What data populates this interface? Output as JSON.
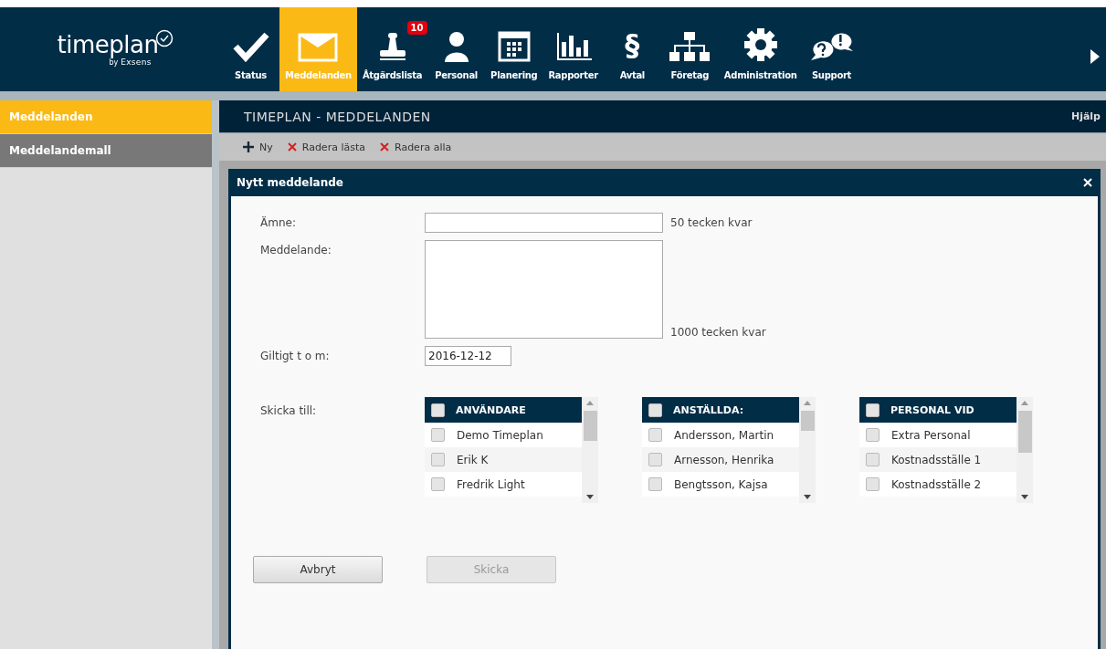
{
  "logo": {
    "name": "timeplan",
    "by": "by",
    "brand": "Exsens"
  },
  "nav": [
    {
      "label": "Status",
      "kind": "check",
      "selected": false
    },
    {
      "label": "Meddelanden",
      "kind": "envelope",
      "selected": true
    },
    {
      "label": "Åtgärdslista",
      "kind": "stamp",
      "selected": false,
      "badge": "10"
    },
    {
      "label": "Personal",
      "kind": "person",
      "selected": false
    },
    {
      "label": "Planering",
      "kind": "calendar",
      "selected": false
    },
    {
      "label": "Rapporter",
      "kind": "chart",
      "selected": false
    },
    {
      "label": "Avtal",
      "kind": "glyph",
      "glyph": "§",
      "selected": false
    },
    {
      "label": "Företag",
      "kind": "org",
      "selected": false
    },
    {
      "label": "Administration",
      "kind": "gear",
      "selected": false
    },
    {
      "label": "Support",
      "kind": "support",
      "selected": false
    }
  ],
  "sidebar": {
    "items": [
      {
        "label": "Meddelanden",
        "selected": true
      },
      {
        "label": "Meddelandemall",
        "selected": false
      }
    ]
  },
  "page": {
    "title": "TIMEPLAN - MEDDELANDEN",
    "help": "Hjälp"
  },
  "toolbar": [
    {
      "label": "Ny",
      "kind": "add"
    },
    {
      "label": "Radera lästa",
      "kind": "delete"
    },
    {
      "label": "Radera alla",
      "kind": "delete"
    }
  ],
  "dialog": {
    "title": "Nytt meddelande",
    "subject": {
      "label": "Ämne:",
      "counter": "50 tecken kvar"
    },
    "message": {
      "label": "Meddelande:",
      "counter": "1000 tecken kvar"
    },
    "valid_until": {
      "label": "Giltigt t o m:",
      "value": "2016-12-12"
    },
    "send_to": {
      "label": "Skicka till:",
      "lists": [
        {
          "header": "ANVÄNDARE",
          "checked": false,
          "items": [
            {
              "name": "Demo Timeplan",
              "checked": false
            },
            {
              "name": "Erik K",
              "checked": false
            },
            {
              "name": "Fredrik Light",
              "checked": false
            }
          ]
        },
        {
          "header": "ANSTÄLLDA:",
          "checked": false,
          "items": [
            {
              "name": "Andersson, Martin",
              "checked": false
            },
            {
              "name": "Arnesson, Henrika",
              "checked": false
            },
            {
              "name": "Bengtsson, Kajsa",
              "checked": false
            }
          ]
        },
        {
          "header": "PERSONAL VID",
          "checked": false,
          "items": [
            {
              "name": "Extra Personal",
              "checked": false
            },
            {
              "name": "Kostnadsställe 1",
              "checked": false
            },
            {
              "name": "Kostnadsställe 2",
              "checked": false
            }
          ]
        }
      ]
    },
    "buttons": [
      {
        "label": "Avbryt",
        "disabled": false
      },
      {
        "label": "Skicka",
        "disabled": true
      }
    ]
  }
}
